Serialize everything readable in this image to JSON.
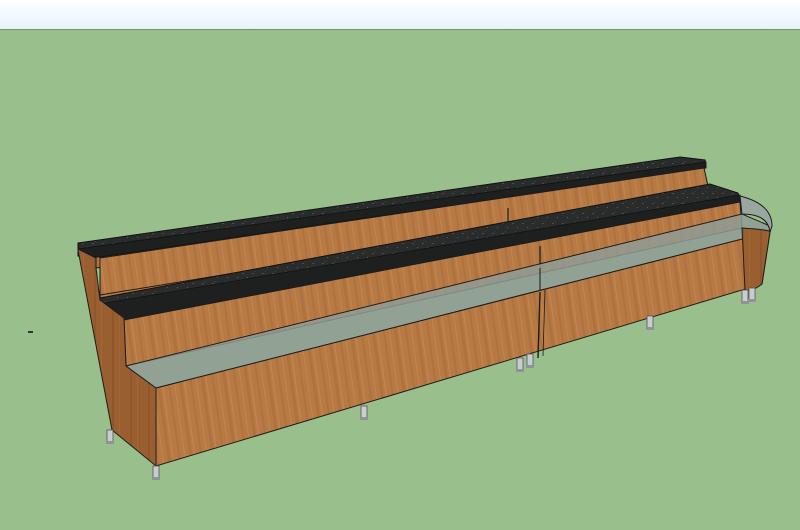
{
  "viewport": {
    "kind": "3d-model-view",
    "sky_color": "#e6f2fc",
    "ground_color": "#98bf8c"
  },
  "model": {
    "object": "tiered counter",
    "tiers": 3,
    "materials": {
      "wood": "#b87a45",
      "wood_dark": "#9a5f30",
      "wood_shadow": "#8a5228",
      "countertop": "#2a2c2c",
      "glass": "#8f9b95",
      "leg_metal": "#c9cdd0",
      "outline": "#1c1c1c"
    }
  }
}
